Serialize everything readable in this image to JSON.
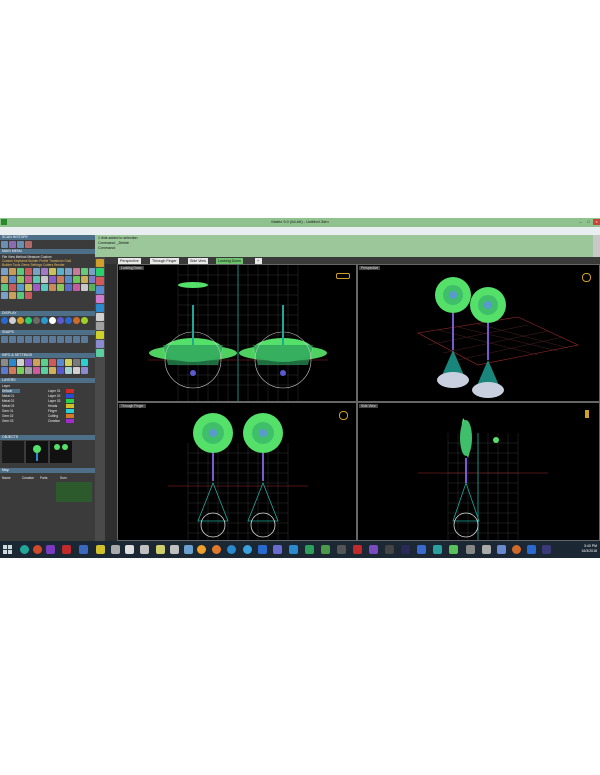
{
  "window": {
    "title": "Matrix 9.0 (64-bit) - Untitled.3dm",
    "controls": [
      "–",
      "□",
      "×"
    ]
  },
  "menu": [
    "File",
    "Edit",
    "View",
    "Curve",
    "Surface",
    "Solid",
    "Mesh",
    "Dimension",
    "Transform",
    "Tools",
    "Analyze",
    "Render",
    "Rhino 9.0",
    "Blend",
    "Gaysi",
    "T-Splines",
    "Help"
  ],
  "left_panel": {
    "sections": [
      "SCAN HISTORY",
      "MAIN MENU",
      "DISPLAY",
      "SNAPS",
      "INFO & SETTINGS",
      "LAYERS",
      "OBJECTS",
      "Map"
    ],
    "main_menu_row1": [
      "File",
      "View",
      "Method",
      "Measure",
      "Custom"
    ],
    "main_menu_row2": [
      "Custom Keyframe",
      "Builder Profile",
      "Transform",
      "Gold"
    ],
    "main_menu_row3": [
      "Builder",
      "Tools",
      "Gems",
      "Settings",
      "Cutters",
      "Render"
    ],
    "layers_header": "Layer",
    "layer_rows": [
      "Default",
      "Metal 01",
      "Metal 02",
      "Metal 03",
      "Gem 01",
      "Gem 02",
      "Gem 03"
    ],
    "layer_rows_right": [
      "Layer 01",
      "Layer 02",
      "Layer 03",
      "Heads",
      "Finger",
      "Cutting",
      "Creation"
    ],
    "map_columns": [
      "Name",
      "Creation",
      "Parts",
      "Sum"
    ]
  },
  "command": {
    "line1": "1 limit added to selection",
    "line2": "Command: _Delete",
    "line3": "Command:"
  },
  "tabs": [
    "Perspective",
    "Through Finger",
    "Side View",
    "Looking Down"
  ],
  "active_tab": "Looking Down",
  "viewports": {
    "top_left": "Looking Down",
    "top_right": "Perspective",
    "bottom_left": "Through Finger",
    "bottom_right": "Side View"
  },
  "taskbar": {
    "time": "3:40 PM",
    "date": "16/3/2018"
  },
  "colors": {
    "accent_green": "#6ec26e",
    "petal_green": "#55e06a",
    "teal_line": "#1fa89a",
    "grid": "#3a3a3a",
    "panel": "#3b3b3b"
  }
}
